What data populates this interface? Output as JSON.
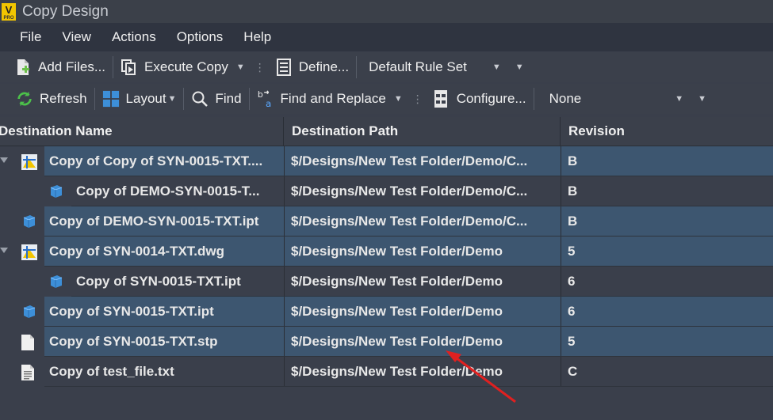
{
  "window": {
    "title": "Copy Design",
    "logo_text": "V",
    "logo_sub": "PRO"
  },
  "menu": [
    "File",
    "View",
    "Actions",
    "Options",
    "Help"
  ],
  "toolbar1": {
    "add_files": "Add Files...",
    "execute_copy": "Execute Copy",
    "define": "Define...",
    "rule_set": "Default Rule Set"
  },
  "toolbar2": {
    "refresh": "Refresh",
    "layout": "Layout",
    "find": "Find",
    "find_replace": "Find and Replace",
    "configure": "Configure...",
    "none": "None"
  },
  "columns": {
    "name": "Destination Name",
    "path": "Destination Path",
    "revision": "Revision"
  },
  "rows": [
    {
      "name": "Copy of Copy of SYN-0015-TXT....",
      "path": "$/Designs/New Test Folder/Demo/C...",
      "revision": "B",
      "icon": "drawing-icon",
      "level": 0,
      "expandable": true,
      "selected": true
    },
    {
      "name": "Copy of DEMO-SYN-0015-T...",
      "path": "$/Designs/New Test Folder/Demo/C...",
      "revision": "B",
      "icon": "part-icon",
      "level": 1,
      "expandable": false,
      "selected": false
    },
    {
      "name": "Copy of DEMO-SYN-0015-TXT.ipt",
      "path": "$/Designs/New Test Folder/Demo/C...",
      "revision": "B",
      "icon": "part-icon",
      "level": 0,
      "expandable": false,
      "selected": true
    },
    {
      "name": "Copy of SYN-0014-TXT.dwg",
      "path": "$/Designs/New Test Folder/Demo",
      "revision": "5",
      "icon": "drawing-icon",
      "level": 0,
      "expandable": true,
      "selected": true
    },
    {
      "name": "Copy of SYN-0015-TXT.ipt",
      "path": "$/Designs/New Test Folder/Demo",
      "revision": "6",
      "icon": "part-icon",
      "level": 1,
      "expandable": false,
      "selected": false
    },
    {
      "name": "Copy of SYN-0015-TXT.ipt",
      "path": "$/Designs/New Test Folder/Demo",
      "revision": "6",
      "icon": "part-icon",
      "level": 0,
      "expandable": false,
      "selected": true
    },
    {
      "name": "Copy of SYN-0015-TXT.stp",
      "path": "$/Designs/New Test Folder/Demo",
      "revision": "5",
      "icon": "document-icon",
      "level": 0,
      "expandable": false,
      "selected": true
    },
    {
      "name": "Copy of test_file.txt",
      "path": "$/Designs/New Test Folder/Demo",
      "revision": "C",
      "icon": "text-file-icon",
      "level": 0,
      "expandable": false,
      "selected": false
    }
  ],
  "colors": {
    "selected_row": "#3d5670",
    "background": "#3a3f4b",
    "annotation_arrow": "#e02020"
  }
}
